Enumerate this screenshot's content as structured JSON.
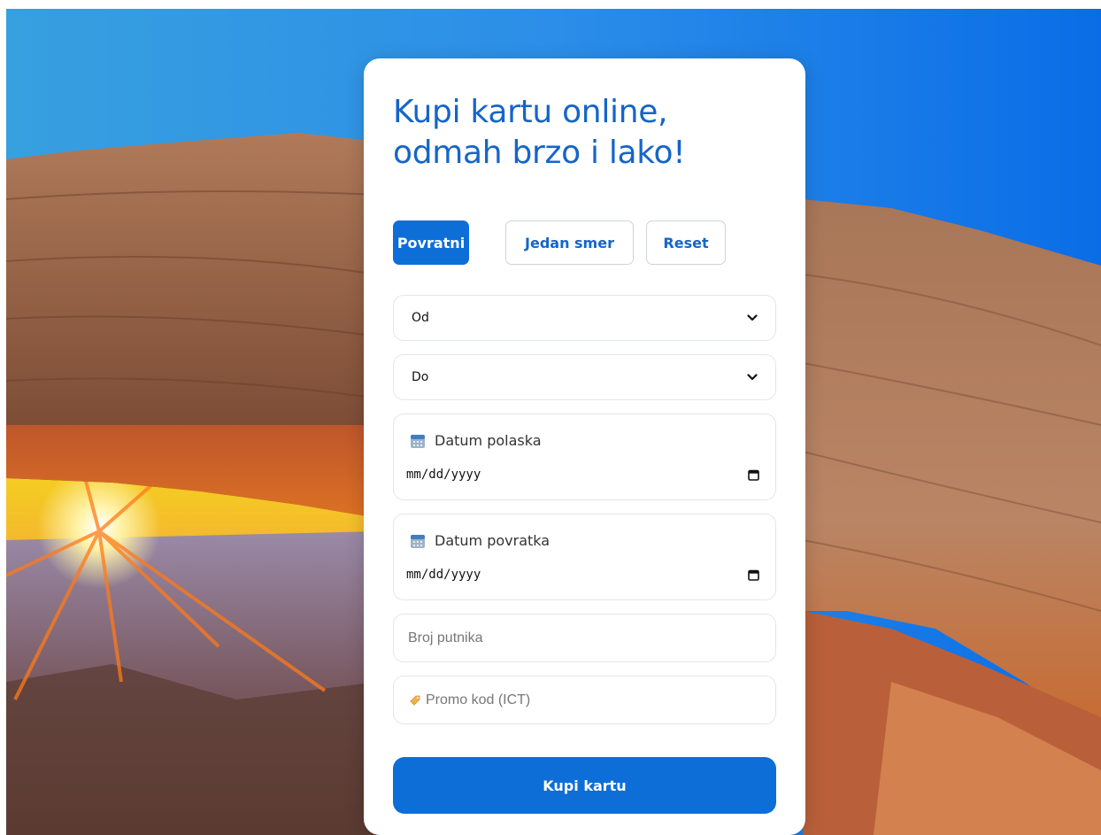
{
  "form": {
    "title": "Kupi kartu online, odmah brzo i lako!",
    "tabs": [
      {
        "label": "Povratni",
        "active": true
      },
      {
        "label": "Jedan smer",
        "active": false
      },
      {
        "label": "Reset",
        "active": false
      }
    ],
    "from_select": {
      "value": "Od"
    },
    "to_select": {
      "value": "Do"
    },
    "departure_date": {
      "label": "Datum polaska",
      "value": "mm/dd/yyyy"
    },
    "return_date": {
      "label": "Datum povratka",
      "value": "mm/dd/yyyy"
    },
    "passengers": {
      "placeholder": "Broj putnika"
    },
    "promo": {
      "placeholder": "Promo kod (ICT)"
    },
    "submit_label": "Kupi kartu"
  },
  "icons": {
    "select_arrow": "chevron-down-icon",
    "date_label": "calendar-icon",
    "date_picker": "calendar-picker-icon",
    "promo": "tag-icon"
  },
  "colors": {
    "primary": "#0d6ed8",
    "title": "#1565c8",
    "border": "#e3e6ea",
    "card": "#ffffff"
  }
}
